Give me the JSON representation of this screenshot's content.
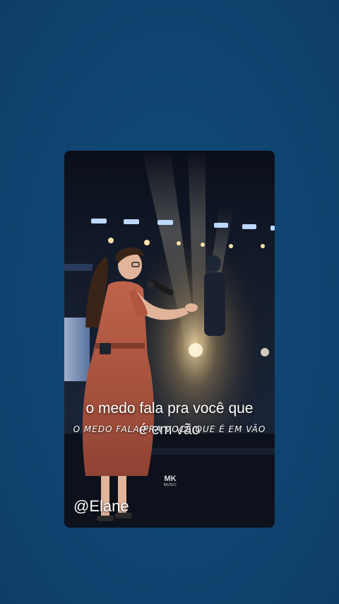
{
  "captions": {
    "line1": "o medo fala pra você que",
    "line2": "é em vão",
    "handwritten": "O MEDO FALA PRA VOCÊ QUE É EM VÃO"
  },
  "overlay": {
    "handle": "@Elane"
  },
  "watermark": {
    "mk": "MK",
    "music": "MUSIC"
  },
  "colors": {
    "background": "#0f4470",
    "dress": "#b0563f",
    "text": "#ffffff"
  }
}
